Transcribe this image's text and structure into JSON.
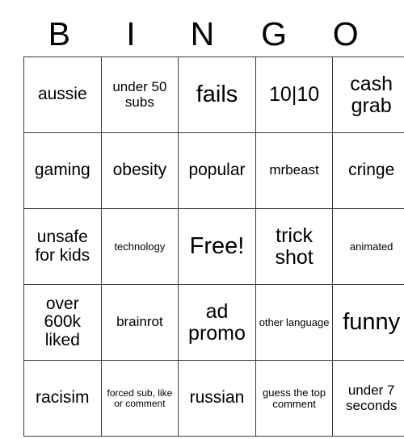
{
  "card": {
    "header_letters": [
      "B",
      "I",
      "N",
      "G",
      "O"
    ],
    "rows": [
      [
        {
          "text": "aussie",
          "size": "md"
        },
        {
          "text": "under 50 subs",
          "size": "sm"
        },
        {
          "text": "fails",
          "size": "xl"
        },
        {
          "text": "10|10",
          "size": "lg"
        },
        {
          "text": "cash grab",
          "size": "lg"
        }
      ],
      [
        {
          "text": "gaming",
          "size": "md"
        },
        {
          "text": "obesity",
          "size": "md"
        },
        {
          "text": "popular",
          "size": "md"
        },
        {
          "text": "mrbeast",
          "size": "sm"
        },
        {
          "text": "cringe",
          "size": "md"
        }
      ],
      [
        {
          "text": "unsafe for kids",
          "size": "md"
        },
        {
          "text": "technology",
          "size": "xs"
        },
        {
          "text": "Free!",
          "size": "xl"
        },
        {
          "text": "trick shot",
          "size": "lg"
        },
        {
          "text": "animated",
          "size": "xs"
        }
      ],
      [
        {
          "text": "over 600k liked",
          "size": "md"
        },
        {
          "text": "brainrot",
          "size": "sm"
        },
        {
          "text": "ad promo",
          "size": "lg"
        },
        {
          "text": "other language",
          "size": "xs"
        },
        {
          "text": "funny",
          "size": "xl"
        }
      ],
      [
        {
          "text": "racisim",
          "size": "md"
        },
        {
          "text": "forced sub, like or comment",
          "size": "xxs"
        },
        {
          "text": "russian",
          "size": "md"
        },
        {
          "text": "guess the top comment",
          "size": "xs"
        },
        {
          "text": "under 7 seconds",
          "size": "sm"
        }
      ]
    ]
  },
  "colors": {
    "background": "#ffffff",
    "border": "#3a3a3a",
    "text": "#000000"
  }
}
